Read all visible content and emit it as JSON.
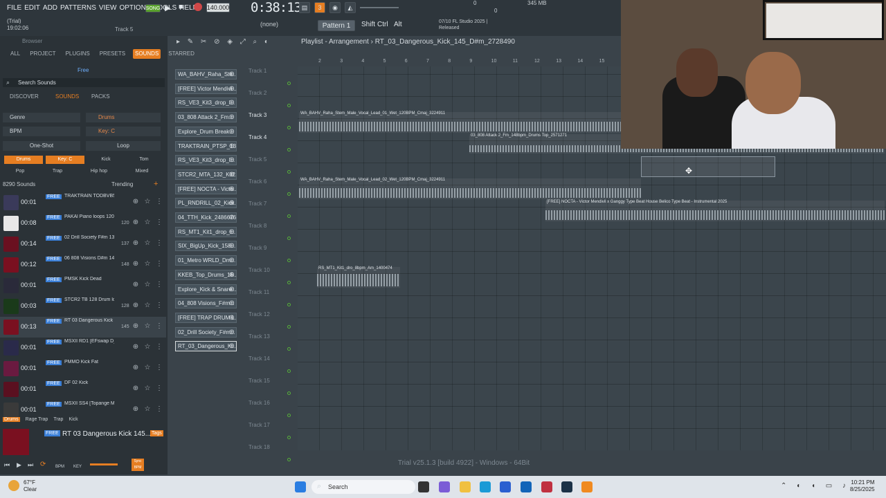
{
  "menu": [
    "FILE",
    "EDIT",
    "ADD",
    "PATTERNS",
    "VIEW",
    "OPTIONS",
    "TOOLS",
    "HELP"
  ],
  "toolbar": {
    "song_label": "SONG",
    "bpm": "140.000",
    "time": "0:38:13",
    "pattern": "Pattern 1",
    "pattern_select": "(none)",
    "shift": "Shift",
    "ctrl": "Ctrl",
    "alt": "Alt",
    "cpu_top": "0",
    "mem": "345 MB",
    "cpu_bot": "0"
  },
  "trial": {
    "line1": "(Trial)",
    "line2": "19:02:06",
    "track_hint": "Track 5"
  },
  "fl_info": {
    "line1": "07/10  FL Studio 2025 |",
    "line2": "Released"
  },
  "browser": {
    "title": "Browser",
    "tabs": [
      "ALL",
      "PROJECT",
      "PLUGINS",
      "PRESETS",
      "SOUNDS",
      "STARRED"
    ],
    "active_tab": "SOUNDS",
    "search_placeholder": "Search Sounds",
    "subtabs": [
      "DISCOVER",
      "SOUNDS",
      "PACKS"
    ],
    "free": "Free",
    "filters": {
      "genre": "Genre",
      "drums": "Drums",
      "bpm": "BPM",
      "key": "Key: C",
      "oneshot": "One-Shot",
      "loop": "Loop"
    },
    "pills": [
      "Drums",
      "Key: C",
      "Kick",
      "Tom",
      "Pop",
      "Trap",
      "Hip hop",
      "Mixed"
    ],
    "count": "8290 Sounds",
    "trending": "Trending",
    "sounds": [
      {
        "dur": "00:01",
        "free": "FREE",
        "name": "TRAKTRAIN TODBVB5 Op...",
        "num": ""
      },
      {
        "dur": "00:08",
        "free": "FREE",
        "name": "PAKAl Piano loops 120 C...",
        "num": "120"
      },
      {
        "dur": "00:14",
        "free": "FREE",
        "name": "02 Drill Society F#m 137...",
        "num": "137"
      },
      {
        "dur": "00:12",
        "free": "FREE",
        "name": "06 808 Visions D#m 148...",
        "num": "148"
      },
      {
        "dur": "00:01",
        "free": "FREE",
        "name": "PMSK Kick Dead",
        "num": ""
      },
      {
        "dur": "00:03",
        "free": "FREE",
        "name": "STCR2 TB 128 Drum loop...",
        "num": "128"
      },
      {
        "dur": "00:13",
        "free": "FREE",
        "name": "RT 03 Dangerous Kick 14...",
        "num": "145"
      },
      {
        "dur": "00:01",
        "free": "FREE",
        "name": "MSXII RD1 [EFswap D][1]...",
        "num": ""
      },
      {
        "dur": "00:01",
        "free": "FREE",
        "name": "PMMO Kick Fat",
        "num": ""
      },
      {
        "dur": "00:01",
        "free": "FREE",
        "name": "DF 02 Kick",
        "num": ""
      },
      {
        "dur": "00:01",
        "free": "FREE",
        "name": "MSXII SS4 [Topange Ma...",
        "num": ""
      }
    ],
    "tags": [
      "Drums",
      "Rage Trap",
      "Trap",
      "Kick"
    ],
    "preview": {
      "free": "FREE",
      "name": "RT 03 Dangerous Kick 145...",
      "tags": "Tags",
      "bpm": "BPM",
      "key": "KEY",
      "sync": "Sync BPM"
    }
  },
  "playlist": {
    "title": "Playlist - Arrangement",
    "breadcrumb": "RT_03_Dangerous_Kick_145_D#m_2728490",
    "ruler": [
      "2",
      "3",
      "4",
      "5",
      "6",
      "7",
      "8",
      "9",
      "10",
      "11",
      "12",
      "13",
      "14",
      "15"
    ],
    "channels": [
      "WA_BAHV_Raha_Ste...",
      "[FREE] Victor Mendivi...",
      "RS_VE3_Kit3_drop_l...",
      "03_808 Attack 2_Fm...",
      "Explore_Drum Break...",
      "TRAKTRAIN_PTSP_13...",
      "RS_VE3_Kit3_drop_l...",
      "STCR2_MTA_132_Kit2...",
      "[FREE] NOCTA - Victo...",
      "PL_RNDRILL_02_Kick...",
      "04_TTH_Kick_2486676",
      "RS_MT1_Kit1_drop_l...",
      "SIX_BigUp_Kick_158...",
      "01_Metro WRLD_Dm...",
      "KKEB_Top_Drums_16...",
      "Explore_Kick & Snare...",
      "04_808 Visions_F#m...",
      "[FREE] TRAP DRUM L...",
      "02_Drill Society_F#m...",
      "RT_03_Dangerous_Ki..."
    ],
    "tracks": [
      "Track 1",
      "Track 2",
      "Track 3",
      "Track 4",
      "Track 5",
      "Track 6",
      "Track 7",
      "Track 8",
      "Track 9",
      "Track 10",
      "Track 11",
      "Track 12",
      "Track 13",
      "Track 14",
      "Track 15",
      "Track 16",
      "Track 17",
      "Track 18"
    ],
    "clips": {
      "c1": "WA_BAHV_Raha_Stem_Male_Vocal_Lead_01_Wet_120BPM_Cmaj_3224911",
      "c1b": "WA_BAHV_Raha_Stem_Male_Vocal_Lead_01_Wet_120BPM_Cmaj_",
      "c2": "03_808 Attack 2_Fm_148bpm_Drums Top_2571271",
      "c3": "WA_BAHV_Raha_Stem_Male_Vocal_Lead_02_Wet_120BPM_Cmaj_3224911",
      "c3b": "WA_BAHV_Raha_Stem_Male_Vocal_Lead_02_Wet_120BPM_Cmaj_3224911",
      "c4": "[FREE] NOCTA - Victor Mendivil x Ganggy Type Beat  House Belico Type Beat - Instrumental 2025",
      "c5": "RS_MT1_Kit1_dro_8bpm_Am_1400474"
    },
    "status": "Trial v25.1.3 [build 4922] - Windows - 64Bit"
  },
  "taskbar": {
    "temp": "67°F",
    "cond": "Clear",
    "search": "Search",
    "time": "10:21 PM",
    "date": "8/25/2025"
  }
}
